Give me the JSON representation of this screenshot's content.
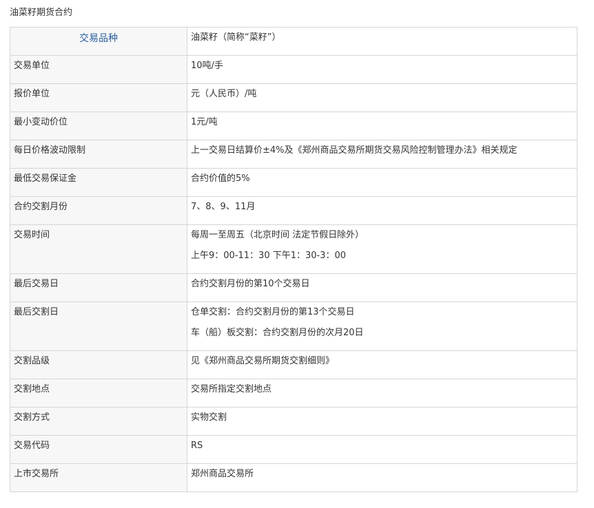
{
  "caption": "油菜籽期货合约",
  "rows": [
    {
      "label": "交易品种",
      "value": [
        "油菜籽（简称“菜籽”）"
      ]
    },
    {
      "label": "交易单位",
      "value": [
        "10吨/手"
      ]
    },
    {
      "label": "报价单位",
      "value": [
        "元（人民币）/吨"
      ]
    },
    {
      "label": "最小变动价位",
      "value": [
        "1元/吨"
      ]
    },
    {
      "label": "每日价格波动限制",
      "value": [
        "上一交易日结算价±4%及《郑州商品交易所期货交易风险控制管理办法》相关规定"
      ]
    },
    {
      "label": "最低交易保证金",
      "value": [
        "合约价值的5%"
      ]
    },
    {
      "label": "合约交割月份",
      "value": [
        "7、8、9、11月"
      ]
    },
    {
      "label": "交易时间",
      "value": [
        "每周一至周五（北京时间 法定节假日除外）",
        "上午9：00-11：30 下午1：30-3：00"
      ]
    },
    {
      "label": "最后交易日",
      "value": [
        "合约交割月份的第10个交易日"
      ]
    },
    {
      "label": "最后交割日",
      "value": [
        "仓单交割：合约交割月份的第13个交易日",
        "车（船）板交割：合约交割月份的次月20日"
      ]
    },
    {
      "label": "交割品级",
      "value": [
        "见《郑州商品交易所期货交割细则》"
      ]
    },
    {
      "label": "交割地点",
      "value": [
        "交易所指定交割地点"
      ]
    },
    {
      "label": "交割方式",
      "value": [
        "实物交割"
      ]
    },
    {
      "label": "交易代码",
      "value": [
        "RS"
      ]
    },
    {
      "label": "上市交易所",
      "value": [
        "郑州商品交易所"
      ]
    }
  ]
}
